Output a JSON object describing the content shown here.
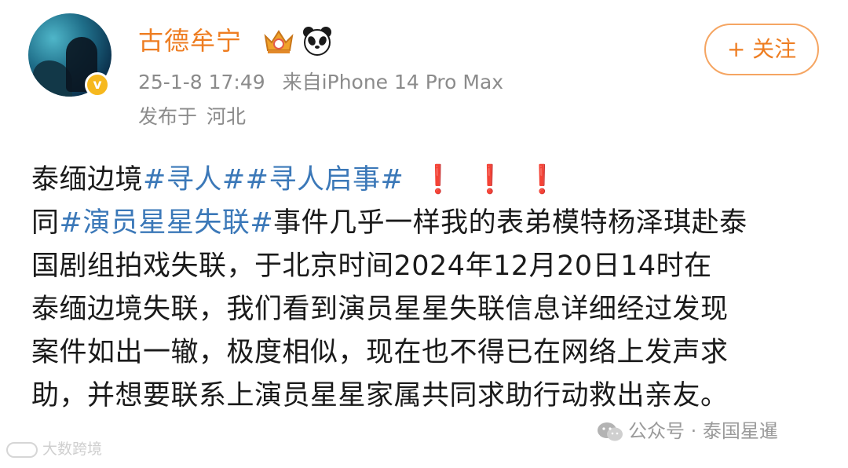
{
  "header": {
    "username": "古德牟宁",
    "verified_mark": "v",
    "timestamp": "25-1-8 17:49",
    "source": "来自iPhone 14 Pro Max",
    "location_prefix": "发布于",
    "location": "河北",
    "follow_label": "+ 关注",
    "colors": {
      "username": "#ee7d21",
      "follow_border": "#f5a562",
      "verified": "#f6b81e"
    },
    "icons": [
      "crown-badge-icon",
      "panda-icon"
    ]
  },
  "post": {
    "line1": {
      "text": "泰缅边境",
      "hashtag1": "#寻人#",
      "hashtag2": "#寻人启事#",
      "alerts": [
        "❗",
        "❗",
        "❗"
      ]
    },
    "line2": {
      "prefix": "同",
      "hashtag": "#演员星星失联#",
      "text": "事件几乎一样我的表弟模特杨泽琪赴泰"
    },
    "line3": "国剧组拍戏失联，于北京时间2024年12月20日14时在",
    "line4": "泰缅边境失联，我们看到演员星星失联信息详细经过发现",
    "line5": "案件如出一辙，极度相似，现在也不得已在网络上发声求",
    "line6": "助，并想要联系上演员星星家属共同求助行动救出亲友。",
    "colors": {
      "hashtag": "#3b78b8",
      "alert": "#e02a2a"
    }
  },
  "watermarks": {
    "left": "大数跨境",
    "right": "公众号 · 泰国星暹"
  }
}
